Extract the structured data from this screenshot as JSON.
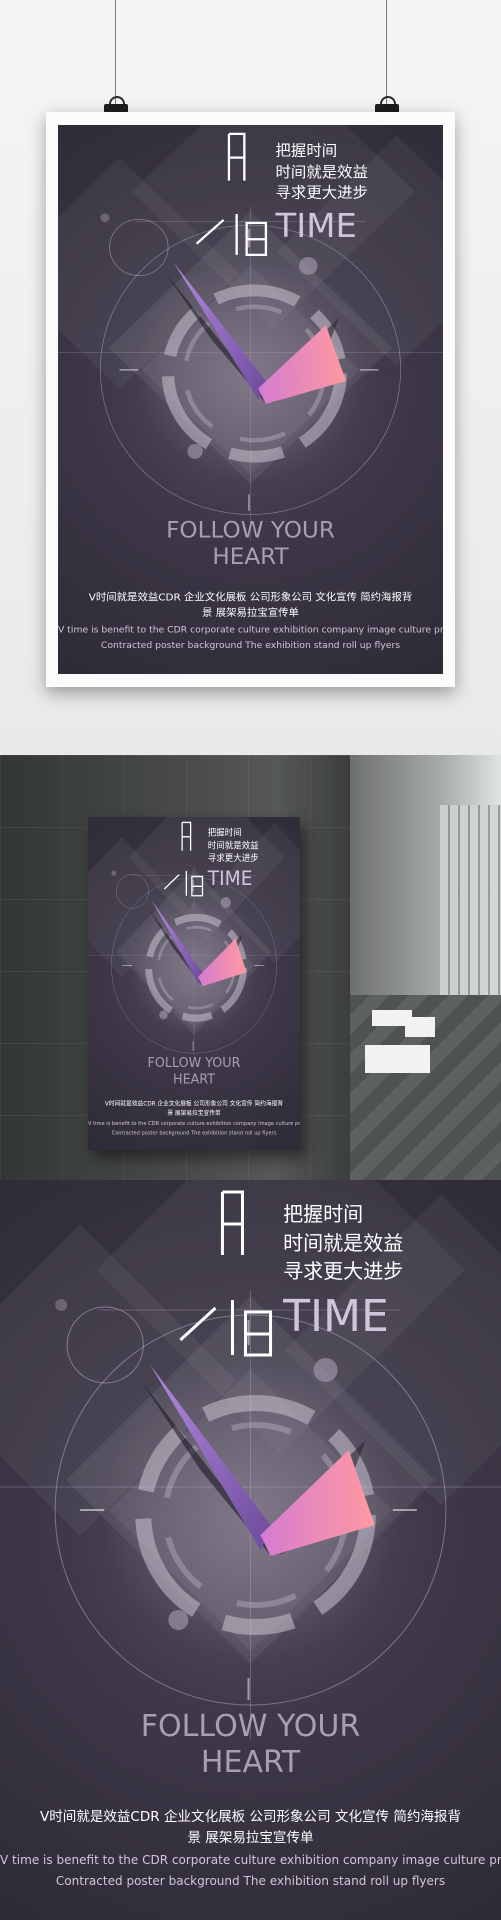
{
  "poster": {
    "title_char_1": "时",
    "title_char_2": "间",
    "tagline_line1": "把握时间",
    "tagline_line2": "时间就是效益",
    "tagline_line3": "寻求更大进步",
    "time_label": "TIME",
    "follow_line1": "FOLLOW YOUR",
    "follow_line2": "HEART",
    "cn_desc_line1": "V时间就是效益CDR 企业文化展板 公司形象公司 文化宣传 简约海报背",
    "cn_desc_line2": "景 展架易拉宝宣传单",
    "en_desc_line1": "V time is benefit to the CDR corporate culture exhibition company image culture propaganda",
    "en_desc_line2": "Contracted poster background The exhibition stand roll up flyers"
  },
  "colors": {
    "poster_bg": "#3a3442",
    "hand_purple": "#8a63b8",
    "hand_pink": "#f08aa6",
    "text_light": "#ffffff",
    "text_muted": "#a79fb2"
  }
}
